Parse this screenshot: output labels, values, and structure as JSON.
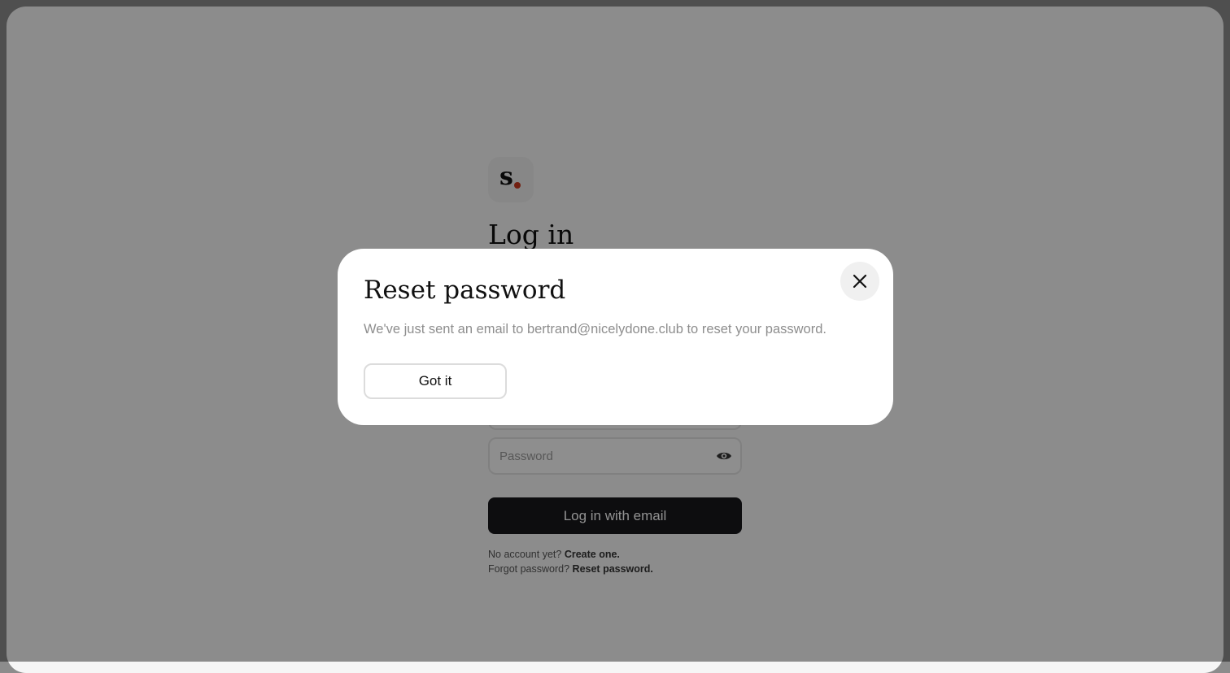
{
  "login": {
    "logo_letter": "s",
    "title": "Log in",
    "password_placeholder": "Password",
    "submit_label": "Log in with email",
    "no_account_text": "No account yet?",
    "create_link": "Create one.",
    "forgot_text": "Forgot password?",
    "reset_link": "Reset password."
  },
  "modal": {
    "title": "Reset password",
    "message": "We've just sent an email to bertrand@nicelydone.club to reset your password.",
    "confirm_label": "Got it",
    "close_icon": "close-icon"
  },
  "colors": {
    "logo_dot": "#c8381d",
    "primary_button": "#18181c",
    "overlay": "rgba(0,0,0,0.43)"
  }
}
